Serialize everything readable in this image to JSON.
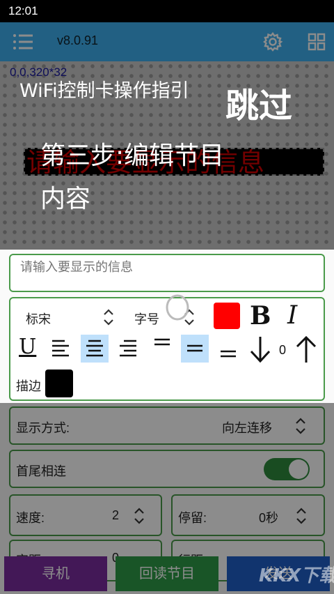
{
  "status_bar": {
    "time": "12:01"
  },
  "app_bar": {
    "menu_icon": "menu-icon",
    "version": "v8.0.91",
    "settings_icon": "gear-icon",
    "grid_icon": "grid-icon"
  },
  "preview": {
    "coords": "0,0,320*32",
    "led_text": "请输入要显示的信息",
    "led_color": "#d20000"
  },
  "message_input": {
    "value": "",
    "placeholder": "请输入要显示的信息"
  },
  "format": {
    "font": "标宋",
    "size_label": "字号",
    "text_color": "#ff0000",
    "bold": "B",
    "italic": "I",
    "underline": "U",
    "spacing_value": "0",
    "stroke_label": "描边",
    "stroke_color": "#000000"
  },
  "display_mode": {
    "label": "显示方式:",
    "value": "向左连移"
  },
  "loop": {
    "label": "首尾相连",
    "on": true
  },
  "speed": {
    "label": "速度:",
    "value": "2"
  },
  "stay": {
    "label": "停留:",
    "value": "0秒"
  },
  "row4": {
    "left_label": "字距",
    "left_value": "0",
    "right_label": "行距"
  },
  "buttons": {
    "find": "寻机",
    "readback": "回读节目",
    "send": "发送"
  },
  "guide": {
    "title": "WiFi控制卡操作指引",
    "skip": "跳过",
    "step_line1": "第三步:编辑节目",
    "step_line2": "内容"
  },
  "watermark": "KKX下载"
}
